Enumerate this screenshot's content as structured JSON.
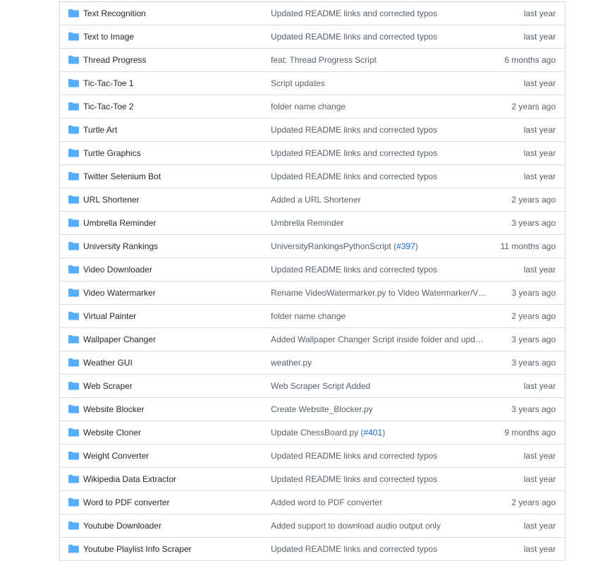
{
  "colors": {
    "folder": "#54aeff",
    "link": "#0969da",
    "muted": "#57606a",
    "border": "#d8dee4"
  },
  "files": [
    {
      "name": "Text Recognition",
      "message": "Updated README links and corrected typos",
      "age": "last year",
      "icon": "folder-icon"
    },
    {
      "name": "Text to Image",
      "message": "Updated README links and corrected typos",
      "age": "last year",
      "icon": "folder-icon"
    },
    {
      "name": "Thread Progress",
      "message": "feat: Thread Progress Script",
      "age": "6 months ago",
      "icon": "folder-icon"
    },
    {
      "name": "Tic-Tac-Toe 1",
      "message": "Script updates",
      "age": "last year",
      "icon": "folder-icon"
    },
    {
      "name": "Tic-Tac-Toe 2",
      "message": "folder name change",
      "age": "2 years ago",
      "icon": "folder-icon"
    },
    {
      "name": "Turtle Art",
      "message": "Updated README links and corrected typos",
      "age": "last year",
      "icon": "folder-icon"
    },
    {
      "name": "Turtle Graphics",
      "message": "Updated README links and corrected typos",
      "age": "last year",
      "icon": "folder-icon"
    },
    {
      "name": "Twitter Selenium Bot",
      "message": "Updated README links and corrected typos",
      "age": "last year",
      "icon": "folder-icon"
    },
    {
      "name": "URL Shortener",
      "message": "Added a URL Shortener",
      "age": "2 years ago",
      "icon": "folder-icon"
    },
    {
      "name": "Umbrella Reminder",
      "message": "Umbrella Reminder",
      "age": "3 years ago",
      "icon": "folder-icon"
    },
    {
      "name": "University Rankings",
      "message": "UniversityRankingsPythonScript (",
      "pr": "#397",
      "message_end": ")",
      "age": "11 months ago",
      "icon": "folder-icon"
    },
    {
      "name": "Video Downloader",
      "message": "Updated README links and corrected typos",
      "age": "last year",
      "icon": "folder-icon"
    },
    {
      "name": "Video Watermarker",
      "message": "Rename VideoWatermarker.py to Video Watermarker/Video…",
      "age": "3 years ago",
      "icon": "folder-icon"
    },
    {
      "name": "Virtual Painter",
      "message": "folder name change",
      "age": "2 years ago",
      "icon": "folder-icon"
    },
    {
      "name": "Wallpaper Changer",
      "message": "Added Wallpaper Changer Script inside folder and updated …",
      "age": "3 years ago",
      "icon": "folder-icon"
    },
    {
      "name": "Weather GUI",
      "message": "weather.py",
      "age": "3 years ago",
      "icon": "folder-icon"
    },
    {
      "name": "Web Scraper",
      "message": "Web Scraper Script Added",
      "age": "last year",
      "icon": "folder-icon"
    },
    {
      "name": "Website Blocker",
      "message": "Create Website_Blocker.py",
      "age": "3 years ago",
      "icon": "folder-icon"
    },
    {
      "name": "Website Cloner",
      "message": "Update ChessBoard.py (",
      "pr": "#401",
      "message_end": ")",
      "age": "9 months ago",
      "icon": "folder-icon"
    },
    {
      "name": "Weight Converter",
      "message": "Updated README links and corrected typos",
      "age": "last year",
      "icon": "folder-icon"
    },
    {
      "name": "Wikipedia Data Extractor",
      "message": "Updated README links and corrected typos",
      "age": "last year",
      "icon": "folder-icon"
    },
    {
      "name": "Word to PDF converter",
      "message": "Added word to PDF converter",
      "age": "2 years ago",
      "icon": "folder-icon"
    },
    {
      "name": "Youtube Downloader",
      "message": "Added support to download audio output only",
      "age": "last year",
      "icon": "folder-icon"
    },
    {
      "name": "Youtube Playlist Info Scraper",
      "message": "Updated README links and corrected typos",
      "age": "last year",
      "icon": "folder-icon"
    }
  ]
}
